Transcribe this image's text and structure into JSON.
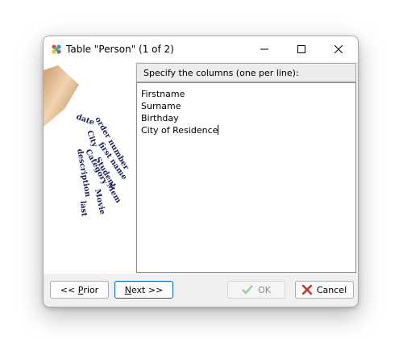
{
  "window": {
    "title": "Table \"Person\" (1 of 2)"
  },
  "side_panel": {
    "words": [
      "date",
      "order number",
      "first name",
      "City",
      "Category",
      "Student",
      "Mem",
      "description",
      "Movie",
      "last"
    ]
  },
  "prompt": "Specify the columns (one per line):",
  "columns_text": [
    "Firstname",
    "Surname",
    "Birthday",
    "City of Residence"
  ],
  "buttons": {
    "prior_prefix": "<< ",
    "prior_mnemonic": "P",
    "prior_rest": "rior",
    "next_mnemonic": "N",
    "next_rest": "ext >>",
    "ok": "OK",
    "cancel": "Cancel"
  },
  "colors": {
    "ok_check": "#9fc79f",
    "cancel_x": "#c0392b",
    "side_text": "#1a1d5c",
    "next_border": "#0067c0"
  }
}
